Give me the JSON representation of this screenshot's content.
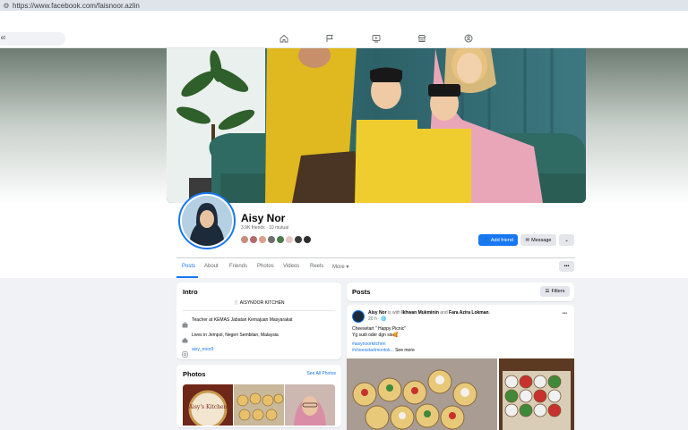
{
  "browser": {
    "url": "https://www.facebook.com/faisnoor.azlin"
  },
  "search": {
    "value": "et"
  },
  "profile": {
    "name": "Aisy Nor",
    "friends": "3.9K friends · 10 mutual",
    "actions": {
      "add_friend": "Add friend",
      "message": "Message"
    }
  },
  "tabs": [
    "Posts",
    "About",
    "Friends",
    "Photos",
    "Videos",
    "Reels",
    "More ▾"
  ],
  "intro": {
    "title": "Intro",
    "bio": "🍴 AISYNOOR KITCHEN",
    "work": "Teacher at KEMAS Jabatan Kemajuan Masyarakat",
    "lives": "Lives in Jempol, Negeri Sembilan, Malaysia",
    "instagram": "aisy_noor9"
  },
  "photos": {
    "title": "Photos",
    "see_all": "See All Photos",
    "cake_text": "Aisy's Kitchen"
  },
  "posts": {
    "title": "Posts",
    "filters": "Filters",
    "post": {
      "author": "Aisy Nor",
      "with_text": " is with ",
      "tagged_1": "Ikhwan Mukminin",
      "and_text": " and ",
      "tagged_2": "Fara Azira Lokman",
      "time": "20 h · 🌐",
      "line1": "Cheesetart \" Happy Picnic\"",
      "line2": "Yg sudi oder dgn sis🥰",
      "tag1": "#aisynoorkitchen",
      "tag2": "#cheesetartmontok...",
      "see_more": " See more"
    }
  },
  "colors": {
    "accent": "#1877f2",
    "page_bg": "#f0f2f5",
    "button_gray": "#e4e6eb"
  },
  "icons": [
    "home-icon",
    "flag-icon",
    "video-icon",
    "marketplace-icon",
    "groups-icon"
  ]
}
